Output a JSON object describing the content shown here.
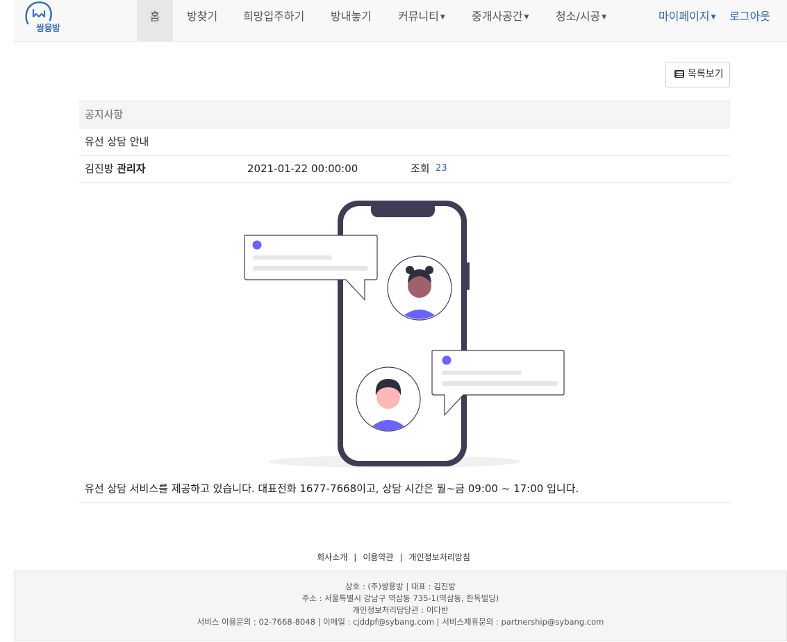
{
  "brand": {
    "logo_text": "쌍용방"
  },
  "nav": {
    "items": [
      {
        "label": "홈"
      },
      {
        "label": "방찾기"
      },
      {
        "label": "희망입주하기"
      },
      {
        "label": "방내놓기"
      },
      {
        "label": "커뮤니티"
      },
      {
        "label": "중개사공간"
      },
      {
        "label": "청소/시공"
      }
    ],
    "right": [
      {
        "label": "마이페이지"
      },
      {
        "label": "로그아웃"
      }
    ]
  },
  "list_button": {
    "label": "목록보기",
    "icon": "list-icon"
  },
  "article": {
    "category": "공지사항",
    "title": "유선 상담 안내",
    "author_name": "김진방",
    "author_role": "관리자",
    "date": "2021-01-22 00:00:00",
    "views_label": "조회",
    "views": "23",
    "content": "유선 상담 서비스를 제공하고 있습니다. 대표전화 1677-7668이고, 상담 시간은 월~금 09:00 ~ 17:00 입니다."
  },
  "illustration": {
    "icon": "phone-chat-illustration",
    "accent": "#6c63ff",
    "frame": "#3f3d56"
  },
  "footer": {
    "links": [
      "회사소개",
      "이용약관",
      "개인정보처리방침"
    ],
    "separator": "|",
    "lines": [
      "상호 : (주)쌍용방 | 대표 : 김진방",
      "주소 : 서울특별시 강남구 역삼동 735-1(역삼동, 한독빌딩)",
      "개인정보처리담당관 : 이다반",
      "서비스 이용문의 : 02-7668-8048 | 이메일 : cjddpf@sybang.com | 서비스제휴문의 : partnership@sybang.com"
    ]
  },
  "colors": {
    "brand_blue": "#2f64ad",
    "nav_bg": "#f8f8f8",
    "active_bg": "#e7e7e7"
  }
}
